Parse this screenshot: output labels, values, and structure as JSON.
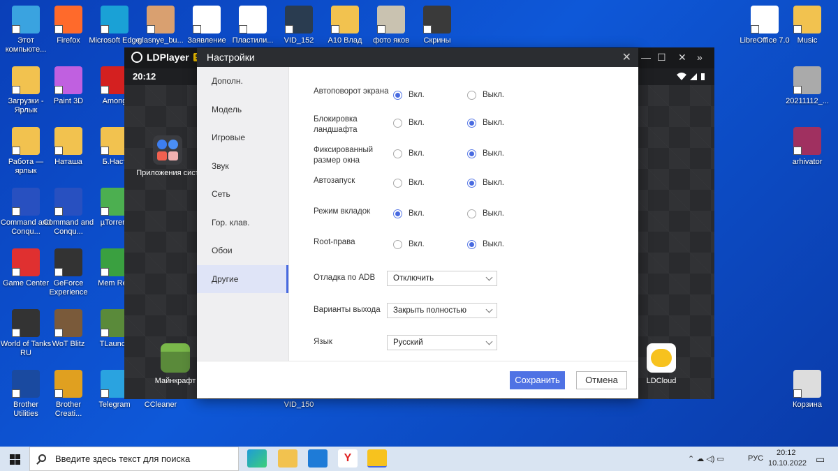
{
  "desktop": {
    "icons": [
      {
        "label": "Этот компьюте...",
        "icon": "computer-icon",
        "color": "#3aa3e0"
      },
      {
        "label": "Firefox",
        "icon": "firefox-icon",
        "color": "#ff6a2b"
      },
      {
        "label": "Microsoft Edge",
        "icon": "edge-icon",
        "color": "#1aa1d6"
      },
      {
        "label": "glasnye_bu...",
        "icon": "image-file-icon",
        "color": "#d9a070"
      },
      {
        "label": "Заявление",
        "icon": "document-icon",
        "color": "#ffffff"
      },
      {
        "label": "Пластили...",
        "icon": "document-icon",
        "color": "#ffffff"
      },
      {
        "label": "VID_152",
        "icon": "video-icon",
        "color": "#2a3c50"
      },
      {
        "label": "А10 Влад",
        "icon": "folder-icon",
        "color": "#f2c24f"
      },
      {
        "label": "фото яков",
        "icon": "folder-icon",
        "color": "#c9c2b0"
      },
      {
        "label": "Скрины",
        "icon": "folder-icon",
        "color": "#3a3a3a"
      },
      {
        "label": "LibreOffice 7.0",
        "icon": "libreoffice-icon",
        "color": "#ffffff"
      },
      {
        "label": "Music",
        "icon": "music-folder-icon",
        "color": "#f2c24f"
      },
      {
        "label": "Загрузки - Ярлык",
        "icon": "downloads-folder-icon",
        "color": "#f2c24f"
      },
      {
        "label": "Paint 3D",
        "icon": "paint3d-icon",
        "color": "#c060e0"
      },
      {
        "label": "Among",
        "icon": "among-us-icon",
        "color": "#d42020"
      },
      {
        "label": "20211112_...",
        "icon": "photo-icon",
        "color": "#aaaaaa"
      },
      {
        "label": "Работа — ярлык",
        "icon": "folder-icon",
        "color": "#f2c24f"
      },
      {
        "label": "Наташа",
        "icon": "folder-icon",
        "color": "#f2c24f"
      },
      {
        "label": "Б.Наст",
        "icon": "folder-icon",
        "color": "#f2c24f"
      },
      {
        "label": "arhivator",
        "icon": "winrar-icon",
        "color": "#a03060"
      },
      {
        "label": "Command and Conqu...",
        "icon": "command-conquer-icon",
        "color": "#2850c0"
      },
      {
        "label": "Command and Conqu...",
        "icon": "command-conquer-icon",
        "color": "#2850c0"
      },
      {
        "label": "µTorrent",
        "icon": "utorrent-icon",
        "color": "#4caf50"
      },
      {
        "label": "Game Center",
        "icon": "game-center-icon",
        "color": "#e03030"
      },
      {
        "label": "GeForce Experience",
        "icon": "geforce-icon",
        "color": "#333333"
      },
      {
        "label": "Mem Red",
        "icon": "memory-icon",
        "color": "#3aa040"
      },
      {
        "label": "World of Tanks RU",
        "icon": "world-of-tanks-icon",
        "color": "#333333"
      },
      {
        "label": "WoT Blitz",
        "icon": "wot-blitz-icon",
        "color": "#7a5a3a"
      },
      {
        "label": "TLaunch",
        "icon": "minecraft-icon",
        "color": "#5a8a3a"
      },
      {
        "label": "Brother Utilities",
        "icon": "brother-utilities-icon",
        "color": "#1a4aa0"
      },
      {
        "label": "Brother Creati...",
        "icon": "brother-creative-icon",
        "color": "#e0a020"
      },
      {
        "label": "Telegram",
        "icon": "telegram-icon",
        "color": "#2aa3e0"
      },
      {
        "label": "CCleaner",
        "icon": "ccleaner-icon",
        "color": "#e04a2a"
      },
      {
        "label": "VID_150",
        "icon": "video-icon",
        "color": "#2a3c50"
      },
      {
        "label": "Корзина",
        "icon": "recycle-bin-icon",
        "color": "#dddddd"
      }
    ]
  },
  "ldplayer": {
    "title": "LDPlayer",
    "version_badge": "9",
    "time": "20:12",
    "apps": {
      "system": "Приложения сист",
      "minecraft": "Майнкрафт",
      "ldcloud": "LDCloud"
    },
    "controls": {
      "minimize": "—",
      "maximize": "☐",
      "close": "✕",
      "expand": "»"
    }
  },
  "settings": {
    "title": "Настройки",
    "close": "✕",
    "sidebar": [
      {
        "label": "Дополн.",
        "active": false
      },
      {
        "label": "Модель",
        "active": false
      },
      {
        "label": "Игровые",
        "active": false
      },
      {
        "label": "Звук",
        "active": false
      },
      {
        "label": "Сеть",
        "active": false
      },
      {
        "label": "Гор. клав.",
        "active": false
      },
      {
        "label": "Обои",
        "active": false
      },
      {
        "label": "Другие",
        "active": true
      }
    ],
    "on_label": "Вкл.",
    "off_label": "Выкл.",
    "toggles": [
      {
        "label": "Автоповорот экрана",
        "value": "on"
      },
      {
        "label": "Блокировка ландшафта",
        "value": "off"
      },
      {
        "label": "Фиксированный размер окна",
        "value": "off"
      },
      {
        "label": "Автозапуск",
        "value": "off"
      },
      {
        "label": "Режим вкладок",
        "value": "on"
      },
      {
        "label": "Root-права",
        "value": "off"
      }
    ],
    "selects": [
      {
        "label": "Отладка по ADB",
        "value": "Отключить"
      },
      {
        "label": "Варианты выхода",
        "value": "Закрыть полностью"
      },
      {
        "label": "Язык",
        "value": "Русский"
      }
    ],
    "save": "Сохранить",
    "cancel": "Отмена"
  },
  "taskbar": {
    "search_placeholder": "Введите здесь текст для поиска",
    "lang": "РУС",
    "time": "20:12",
    "date": "10.10.2022"
  },
  "colors": {
    "accent": "#4769e0",
    "desktop": "#0e58d8"
  }
}
